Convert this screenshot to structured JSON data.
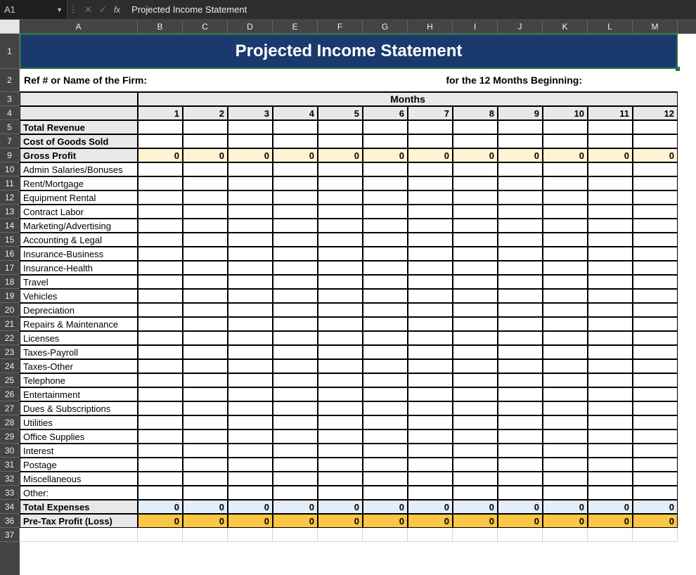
{
  "formula_bar": {
    "cell_ref": "A1",
    "fx_label": "fx",
    "value": "Projected Income Statement"
  },
  "columns": [
    "A",
    "B",
    "C",
    "D",
    "E",
    "F",
    "G",
    "H",
    "I",
    "J",
    "K",
    "L",
    "M"
  ],
  "row_numbers": [
    1,
    2,
    3,
    4,
    5,
    7,
    9,
    10,
    11,
    12,
    13,
    14,
    15,
    16,
    17,
    18,
    19,
    20,
    21,
    22,
    23,
    24,
    25,
    26,
    27,
    28,
    29,
    30,
    31,
    32,
    33,
    34,
    36,
    37
  ],
  "title": "Projected Income Statement",
  "ref_label": "Ref # or Name of the Firm:",
  "months_begin_label": "for the 12 Months Beginning:",
  "months_header": "Months",
  "month_numbers": [
    1,
    2,
    3,
    4,
    5,
    6,
    7,
    8,
    9,
    10,
    11,
    12
  ],
  "rows": [
    {
      "label": "Total Revenue",
      "bold": true,
      "shade": "grey",
      "values": [
        "",
        "",
        "",
        "",
        "",
        "",
        "",
        "",
        "",
        "",
        "",
        ""
      ]
    },
    {
      "label": "Cost of Goods Sold",
      "bold": true,
      "shade": "grey",
      "values": [
        "",
        "",
        "",
        "",
        "",
        "",
        "",
        "",
        "",
        "",
        "",
        ""
      ]
    },
    {
      "label": "Gross Profit",
      "bold": true,
      "shade": "grey",
      "cell_shade": "cream",
      "values": [
        0,
        0,
        0,
        0,
        0,
        0,
        0,
        0,
        0,
        0,
        0,
        0
      ]
    },
    {
      "label": "Admin Salaries/Bonuses",
      "values": [
        "",
        "",
        "",
        "",
        "",
        "",
        "",
        "",
        "",
        "",
        "",
        ""
      ]
    },
    {
      "label": "Rent/Mortgage",
      "values": [
        "",
        "",
        "",
        "",
        "",
        "",
        "",
        "",
        "",
        "",
        "",
        ""
      ]
    },
    {
      "label": "Equipment Rental",
      "values": [
        "",
        "",
        "",
        "",
        "",
        "",
        "",
        "",
        "",
        "",
        "",
        ""
      ]
    },
    {
      "label": "Contract Labor",
      "values": [
        "",
        "",
        "",
        "",
        "",
        "",
        "",
        "",
        "",
        "",
        "",
        ""
      ]
    },
    {
      "label": "Marketing/Advertising",
      "values": [
        "",
        "",
        "",
        "",
        "",
        "",
        "",
        "",
        "",
        "",
        "",
        ""
      ]
    },
    {
      "label": "Accounting & Legal",
      "values": [
        "",
        "",
        "",
        "",
        "",
        "",
        "",
        "",
        "",
        "",
        "",
        ""
      ]
    },
    {
      "label": "Insurance-Business",
      "values": [
        "",
        "",
        "",
        "",
        "",
        "",
        "",
        "",
        "",
        "",
        "",
        ""
      ]
    },
    {
      "label": "Insurance-Health",
      "values": [
        "",
        "",
        "",
        "",
        "",
        "",
        "",
        "",
        "",
        "",
        "",
        ""
      ]
    },
    {
      "label": "Travel",
      "values": [
        "",
        "",
        "",
        "",
        "",
        "",
        "",
        "",
        "",
        "",
        "",
        ""
      ]
    },
    {
      "label": "Vehicles",
      "values": [
        "",
        "",
        "",
        "",
        "",
        "",
        "",
        "",
        "",
        "",
        "",
        ""
      ]
    },
    {
      "label": "Depreciation",
      "values": [
        "",
        "",
        "",
        "",
        "",
        "",
        "",
        "",
        "",
        "",
        "",
        ""
      ]
    },
    {
      "label": "Repairs & Maintenance",
      "values": [
        "",
        "",
        "",
        "",
        "",
        "",
        "",
        "",
        "",
        "",
        "",
        ""
      ]
    },
    {
      "label": "Licenses",
      "values": [
        "",
        "",
        "",
        "",
        "",
        "",
        "",
        "",
        "",
        "",
        "",
        ""
      ]
    },
    {
      "label": "Taxes-Payroll",
      "values": [
        "",
        "",
        "",
        "",
        "",
        "",
        "",
        "",
        "",
        "",
        "",
        ""
      ]
    },
    {
      "label": "Taxes-Other",
      "values": [
        "",
        "",
        "",
        "",
        "",
        "",
        "",
        "",
        "",
        "",
        "",
        ""
      ]
    },
    {
      "label": "Telephone",
      "values": [
        "",
        "",
        "",
        "",
        "",
        "",
        "",
        "",
        "",
        "",
        "",
        ""
      ]
    },
    {
      "label": "Entertainment",
      "values": [
        "",
        "",
        "",
        "",
        "",
        "",
        "",
        "",
        "",
        "",
        "",
        ""
      ]
    },
    {
      "label": "Dues & Subscriptions",
      "values": [
        "",
        "",
        "",
        "",
        "",
        "",
        "",
        "",
        "",
        "",
        "",
        ""
      ]
    },
    {
      "label": "Utilities",
      "values": [
        "",
        "",
        "",
        "",
        "",
        "",
        "",
        "",
        "",
        "",
        "",
        ""
      ]
    },
    {
      "label": "Office Supplies",
      "values": [
        "",
        "",
        "",
        "",
        "",
        "",
        "",
        "",
        "",
        "",
        "",
        ""
      ]
    },
    {
      "label": "Interest",
      "values": [
        "",
        "",
        "",
        "",
        "",
        "",
        "",
        "",
        "",
        "",
        "",
        ""
      ]
    },
    {
      "label": "Postage",
      "values": [
        "",
        "",
        "",
        "",
        "",
        "",
        "",
        "",
        "",
        "",
        "",
        ""
      ]
    },
    {
      "label": "Miscellaneous",
      "values": [
        "",
        "",
        "",
        "",
        "",
        "",
        "",
        "",
        "",
        "",
        "",
        ""
      ]
    },
    {
      "label": "Other:",
      "values": [
        "",
        "",
        "",
        "",
        "",
        "",
        "",
        "",
        "",
        "",
        "",
        ""
      ]
    },
    {
      "label": "Total Expenses",
      "bold": true,
      "shade": "grey",
      "cell_shade": "lightblue",
      "values": [
        0,
        0,
        0,
        0,
        0,
        0,
        0,
        0,
        0,
        0,
        0,
        0
      ]
    },
    {
      "label": "Pre-Tax Profit (Loss)",
      "bold": true,
      "shade": "grey",
      "cell_shade": "gold",
      "values": [
        0,
        0,
        0,
        0,
        0,
        0,
        0,
        0,
        0,
        0,
        0,
        0
      ]
    }
  ],
  "row_heights": {
    "1": 50,
    "2": 33,
    "3": 20,
    "4": 20,
    "5": 20,
    "7": 20,
    "9": 20,
    "10": 20,
    "11": 20,
    "12": 20,
    "13": 20,
    "14": 20,
    "15": 20,
    "16": 20,
    "17": 20,
    "18": 20,
    "19": 20,
    "20": 20,
    "21": 20,
    "22": 20,
    "23": 20,
    "24": 20,
    "25": 20,
    "26": 20,
    "27": 20,
    "28": 20,
    "29": 20,
    "30": 20,
    "31": 20,
    "32": 20,
    "33": 20,
    "34": 20,
    "36": 20,
    "37": 20
  }
}
